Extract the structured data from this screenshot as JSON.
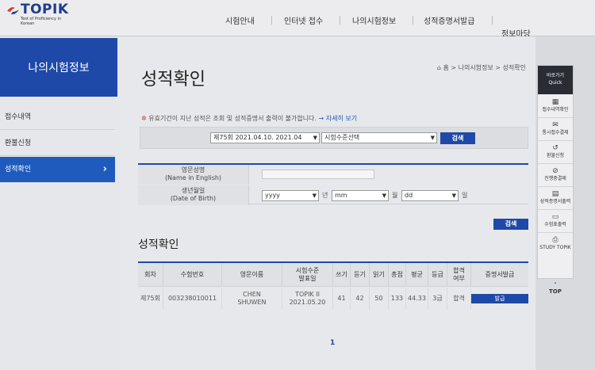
{
  "logo": {
    "word": "TOPIK",
    "tagline": "Test of Proficiency in Korean"
  },
  "nav": [
    "시험안내",
    "인터넷 접수",
    "나의시험정보",
    "성적증명서발급",
    "정보마당"
  ],
  "sidebar": {
    "title": "나의시험정보",
    "items": [
      {
        "label": "접수내역"
      },
      {
        "label": "환불신청"
      },
      {
        "label": "성적확인",
        "chevron": "›"
      }
    ]
  },
  "page": {
    "title": "성적확인",
    "breadcrumb": "홈 > 나의시험정보 > 성적확인"
  },
  "notice": {
    "text": "유효기간이 지난 성적은 조회 및 성적증명서 출력이 불가합니다.",
    "link": "→ 자세히 보기"
  },
  "search": {
    "round": "제75회 2021.04.10. 2021.04",
    "level": "시험수준선택",
    "button": "검색"
  },
  "form": {
    "name_label_ko": "영문성명",
    "name_label_en": "(Name in English)",
    "dob_label_ko": "생년월일",
    "dob_label_en": "(Date of Birth)",
    "year_placeholder": "yyyy",
    "month_placeholder": "mm",
    "day_placeholder": "dd",
    "year_unit": "년",
    "month_unit": "월",
    "day_unit": "일",
    "button": "검색"
  },
  "results": {
    "title": "성적확인",
    "headers": {
      "round": "회차",
      "reg_no": "수험번호",
      "name": "영문이름",
      "level_1": "시험수준",
      "level_2": "발표일",
      "writing": "쓰기",
      "listening": "듣기",
      "reading": "읽기",
      "total": "총점",
      "average": "평균",
      "grade": "등급",
      "pass_1": "합격",
      "pass_2": "여부",
      "cert": "증명서발급"
    },
    "row": {
      "round": "제75회",
      "reg_no": "003238010011",
      "name_1": "CHEN",
      "name_2": "SHUWEN",
      "level_1": "TOPIK II",
      "level_2": "2021.05.20",
      "writing": "41",
      "listening": "42",
      "reading": "50",
      "total": "133",
      "average": "44.33",
      "grade": "3급",
      "pass": "합격",
      "cert_button": "발급"
    },
    "page": "1"
  },
  "quick": {
    "head_1": "바로가기",
    "head_2": "Quick",
    "items": [
      {
        "icon": "▦",
        "label": "접수내역확인"
      },
      {
        "icon": "✉",
        "label": "통시접수결제"
      },
      {
        "icon": "↺",
        "label": "환불신청"
      },
      {
        "icon": "⊘",
        "label": "진행중결제"
      },
      {
        "icon": "▤",
        "label": "성적증명서출력"
      },
      {
        "icon": "▭",
        "label": "수험표출력"
      },
      {
        "icon": "⎙",
        "label": "STUDY TOPIK"
      }
    ],
    "top_arrow": "˄",
    "top_label": "TOP"
  }
}
